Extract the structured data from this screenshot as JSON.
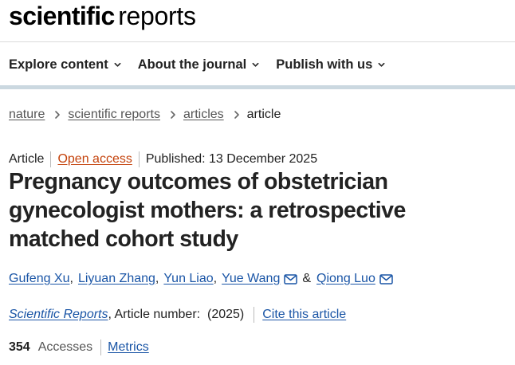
{
  "header": {
    "logo_bold": "scientific",
    "logo_light": "reports"
  },
  "nav": {
    "items": [
      {
        "label": "Explore content"
      },
      {
        "label": "About the journal"
      },
      {
        "label": "Publish with us"
      }
    ]
  },
  "breadcrumb": {
    "items": [
      "nature",
      "scientific reports",
      "articles"
    ],
    "current": "article"
  },
  "article": {
    "type": "Article",
    "access": "Open access",
    "published": "Published: 13 December 2025",
    "title": "Pregnancy outcomes of obstetrician gynecologist mothers: a retrospective matched cohort study",
    "authors": [
      "Gufeng Xu",
      "Liyuan Zhang",
      "Yun Liao",
      "Yue Wang",
      "Qiong Luo"
    ],
    "author_separator_amp": "&",
    "journal": "Scientific Reports",
    "article_number_text": ", Article number:  (2025)",
    "cite_label": "Cite this article",
    "accesses_count": "354",
    "accesses_label": "Accesses",
    "metrics_label": "Metrics"
  },
  "icons": {
    "nav_chevron": "chevron-down-icon",
    "breadcrumb_separator": "chevron-right-icon",
    "author_email": "email-icon"
  },
  "colors": {
    "link": "#1a55a6",
    "open_access": "#c4420b",
    "nav_underline": "#cbd8e0"
  }
}
